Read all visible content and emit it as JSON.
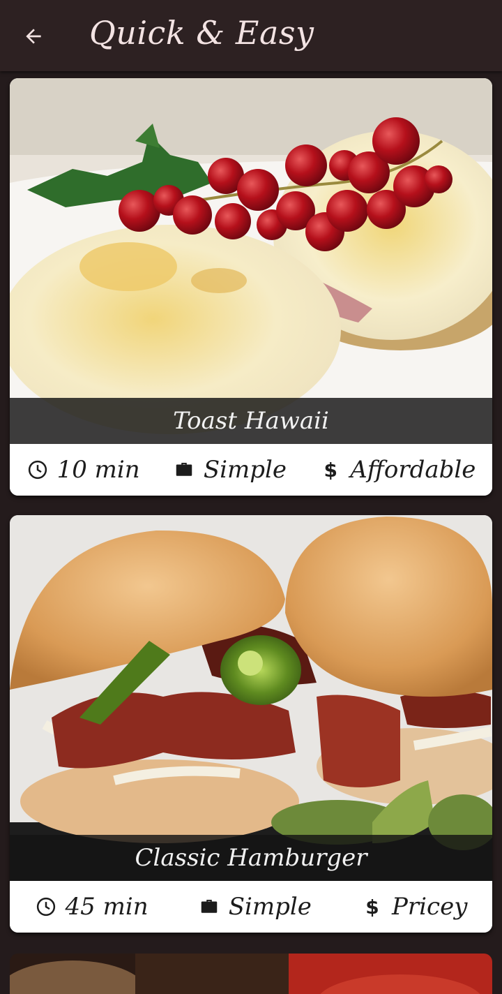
{
  "header": {
    "title": "Quick & Easy",
    "back_icon": "arrow-left-icon"
  },
  "colors": {
    "appbar": "#2d2122",
    "background": "#241b1c",
    "title_text": "#f3e3e3"
  },
  "meals": [
    {
      "title": "Toast Hawaii",
      "duration": "10 min",
      "complexity": "Simple",
      "affordability": "Affordable"
    },
    {
      "title": "Classic Hamburger",
      "duration": "45 min",
      "complexity": "Simple",
      "affordability": "Pricey"
    }
  ],
  "icons": {
    "duration": "clock-icon",
    "complexity": "briefcase-icon",
    "affordability": "dollar-icon"
  },
  "symbols": {
    "dollar": "$"
  }
}
